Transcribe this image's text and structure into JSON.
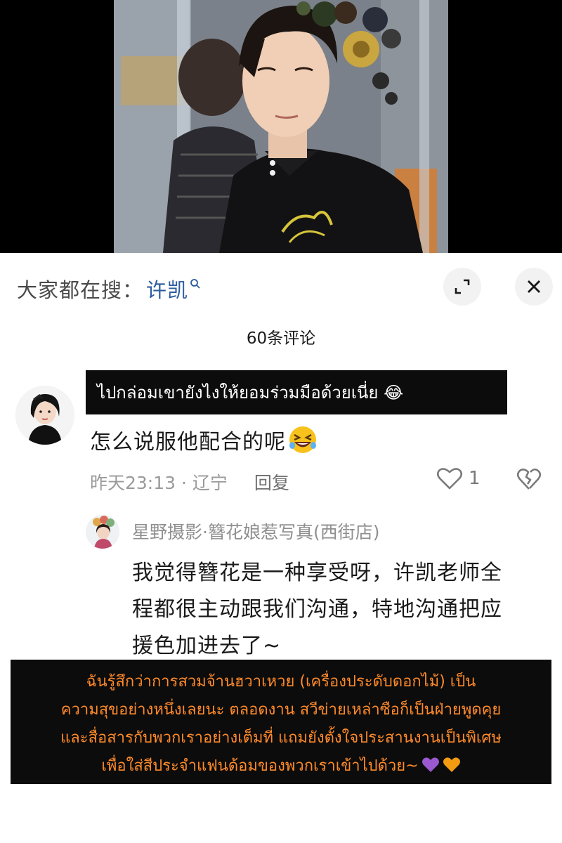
{
  "search": {
    "label": "大家都在搜：",
    "term": "许凯"
  },
  "comments_header": {
    "count_text": "60条评论"
  },
  "comment": {
    "thai_translation": "ไปกล่อมเขายังไงให้ยอมร่วมมือด้วยเนี่ย 😂",
    "text": "怎么说服他配合的呢",
    "emoji": "grinning-squinting-face-icon",
    "time_location": "昨天23:13 · 辽宁",
    "reply_label": "回复",
    "like_count": "1"
  },
  "reply": {
    "author": "星野摄影·簪花娘惹写真(西街店)",
    "lines": [
      "我觉得簪花是一种享受呀，许凯老师全",
      "程都很主动跟我们沟通，特地沟通把应",
      "援色加进去了~"
    ],
    "thai_translation": [
      "ฉันรู้สึกว่าการสวมจ้านฮวาเหวย (เครื่องประดับดอกไม้) เป็น",
      "ความสุขอย่างหนึ่งเลยนะ ตลอดงาน สวีข่ายเหล่าซือก็เป็นฝ่ายพูดคุย",
      "และสื่อสารกับพวกเราอย่างเต็มที่ แถมยังตั้งใจประสานงานเป็นพิเศษ",
      "เพื่อใส่สีประจำแฟนด้อมของพวกเราเข้าไปด้วย~"
    ]
  },
  "colors": {
    "search_term": "#2b5c9e",
    "caption_bg": "#0c0c0c",
    "caption_text_orange": "#ff8a2a",
    "meta_gray": "#9a9a9a",
    "heart_purple": "#9b59d0",
    "heart_orange": "#f39c12"
  }
}
